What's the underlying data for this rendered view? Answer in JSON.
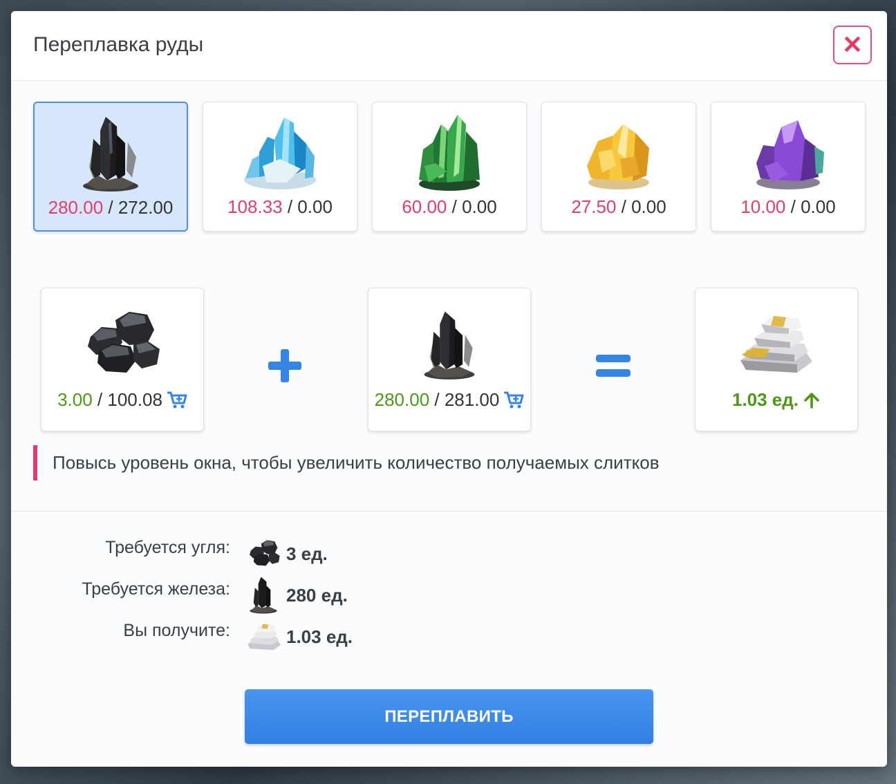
{
  "dialog": {
    "title": "Переплавка руды",
    "close_icon": "close-icon",
    "accent_color": "#e8376a",
    "primary_color": "#3585e5"
  },
  "ores": [
    {
      "name": "black-crystal",
      "have": "280.00",
      "sep": " / ",
      "total": "272.00",
      "selected": true
    },
    {
      "name": "blue-crystal",
      "have": "108.33",
      "sep": " / ",
      "total": "0.00",
      "selected": false
    },
    {
      "name": "green-crystal",
      "have": "60.00",
      "sep": " / ",
      "total": "0.00",
      "selected": false
    },
    {
      "name": "yellow-crystal",
      "have": "27.50",
      "sep": " / ",
      "total": "0.00",
      "selected": false
    },
    {
      "name": "purple-crystal",
      "have": "10.00",
      "sep": " / ",
      "total": "0.00",
      "selected": false
    }
  ],
  "recipe": {
    "coal": {
      "have": "3.00",
      "sep": " / ",
      "total": "100.08",
      "icon": "cart-plus-icon"
    },
    "plus": "+",
    "ore": {
      "have": "280.00",
      "sep": " / ",
      "total": "281.00",
      "icon": "cart-plus-icon"
    },
    "equals": "=",
    "result": {
      "value": "1.03 ед.",
      "icon": "arrow-up-icon"
    }
  },
  "notice": "Повысь уровень окна, чтобы увеличить количество получаемых слитков",
  "summary": [
    {
      "label": "Требуется угля:",
      "value": "3 ед.",
      "icon": "coal-icon"
    },
    {
      "label": "Требуется железа:",
      "value": "280 ед.",
      "icon": "black-crystal-icon"
    },
    {
      "label": "Вы получите:",
      "value": "1.03 ед.",
      "icon": "ingot-icon"
    }
  ],
  "action": {
    "label": "ПЕРЕПЛАВИТЬ"
  }
}
